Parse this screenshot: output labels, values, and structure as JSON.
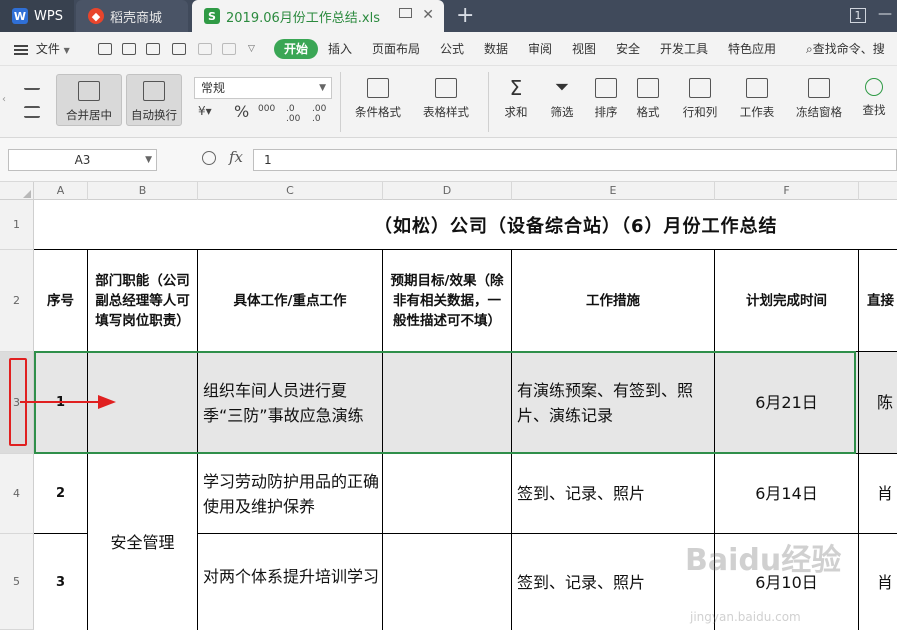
{
  "tabs": {
    "wps": "WPS",
    "store": "稻壳商城",
    "doc": "2019.06月份工作总结.xls",
    "count": "1"
  },
  "menu": {
    "file": "文件",
    "start": "开始",
    "items": [
      "插入",
      "页面布局",
      "公式",
      "数据",
      "审阅",
      "视图",
      "安全",
      "开发工具",
      "特色应用"
    ],
    "search": "查找命令、搜"
  },
  "ribbon": {
    "merge_center": "合并居中",
    "wrap_text": "自动换行",
    "number_format": "常规",
    "percent": "%",
    "thousands": "000",
    "cond_format": "条件格式",
    "table_style": "表格样式",
    "sum": "求和",
    "filter": "筛选",
    "sort": "排序",
    "format": "格式",
    "row_col": "行和列",
    "worksheet": "工作表",
    "freeze": "冻结窗格",
    "find": "查找"
  },
  "formula_bar": {
    "cell_ref": "A3",
    "fx": "fx",
    "value": "1"
  },
  "columns": [
    "A",
    "B",
    "C",
    "D",
    "E",
    "F"
  ],
  "rows": [
    "1",
    "2",
    "3",
    "4",
    "5"
  ],
  "sheet": {
    "title": "（如松）公司（设备综合站）（6）月份工作总结",
    "headers": {
      "no": "序号",
      "dept": "部门职能（公司副总经理等人可填写岗位职责）",
      "work": "具体工作/重点工作",
      "target": "预期目标/效果（除非有相关数据，一般性描述可不填）",
      "measures": "工作措施",
      "plan_time": "计划完成时间",
      "owner": "直接"
    },
    "dept_merged": "安全管理",
    "data": [
      {
        "no": "1",
        "work": "组织车间人员进行夏季“三防”事故应急演练",
        "measures": "有演练预案、有签到、照片、演练记录",
        "time": "6月21日",
        "owner": "陈"
      },
      {
        "no": "2",
        "work": "学习劳动防护用品的正确使用及维护保养",
        "measures": "签到、记录、照片",
        "time": "6月14日",
        "owner": "肖"
      },
      {
        "no": "3",
        "work": "对两个体系提升培训学习",
        "measures": "签到、记录、照片",
        "time": "6月10日",
        "owner": "肖"
      }
    ]
  },
  "watermark": {
    "main": "Baidu经验",
    "sub": "jingyan.baidu.com"
  },
  "colors": {
    "accent": "#3aa655",
    "annotation": "#e02020",
    "selection": "#2f8f4a"
  }
}
